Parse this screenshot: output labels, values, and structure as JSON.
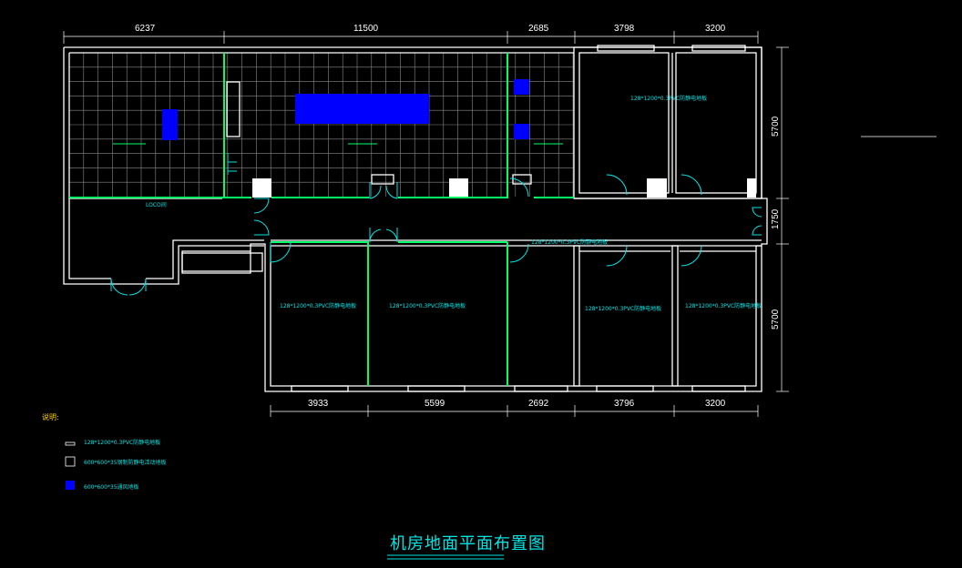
{
  "title": "机房地面平面布置图",
  "colors": {
    "background": "#000000",
    "wall": "#ffffff",
    "partition": "#00ff66",
    "annotation": "#00e5e5",
    "equipment": "#0000ff",
    "legend_title": "#ffd400"
  },
  "dims_top": [
    "6237",
    "11500",
    "2685",
    "3798",
    "3200"
  ],
  "dims_bottom": [
    "3933",
    "5599",
    "2692",
    "3796",
    "3200"
  ],
  "dims_right": [
    "5700",
    "1750",
    "5700"
  ],
  "room_labels": {
    "corridor_ups": "LOCO间",
    "pvc_top_right": "128*1200*0.3PVC防静电地板",
    "pvc_bottom_1": "128*1200*0.3PVC防静电地板",
    "pvc_bottom_2": "128*1200*0.3PVC防静电地板",
    "pvc_bottom_4": "128*1200*0.3PVC防静电地板",
    "pvc_bottom_5": "128*1200*0.3PVC防静电地板",
    "pvc_corridor": "128*1200*0.3PVC防静电地板"
  },
  "legend": {
    "title": "说明:",
    "items": [
      {
        "symbol": "pvc",
        "label": "128*1200*0.3PVC防静电地板"
      },
      {
        "symbol": "raised",
        "label": "600*600*35钢制防静电活动地板"
      },
      {
        "symbol": "equipment",
        "label": "600*600*35通风地板"
      }
    ]
  }
}
